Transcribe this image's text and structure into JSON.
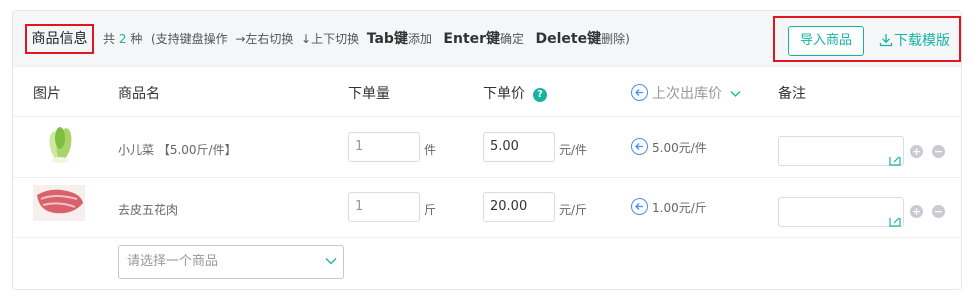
{
  "toolbar": {
    "title": "商品信息",
    "total_prefix": "共",
    "total_count": "2",
    "total_suffix": "种",
    "hint_intro": "(支持键盘操作",
    "hint_lr": "→左右切换",
    "hint_ud": "↓上下切换",
    "tab_key": "Tab键",
    "tab_action": "添加",
    "enter_key": "Enter键",
    "enter_action": "确定",
    "delete_key": "Delete键",
    "delete_action": "删除)",
    "import_label": "导入商品",
    "download_label": "下载模版"
  },
  "columns": {
    "image": "图片",
    "name": "商品名",
    "quantity": "下单量",
    "price": "下单价",
    "help": "?",
    "last_price": "上次出库价",
    "remark": "备注"
  },
  "rows": [
    {
      "name": "小儿菜 【5.00斤/件】",
      "quantity": "1",
      "quantity_unit": "件",
      "price": "5.00",
      "price_unit": "元/件",
      "last_price": "5.00元/件"
    },
    {
      "name": "去皮五花肉",
      "quantity": "1",
      "quantity_unit": "斤",
      "price": "20.00",
      "price_unit": "元/斤",
      "last_price": "1.00元/斤"
    }
  ],
  "add_row": {
    "placeholder": "请选择一个商品"
  },
  "row_actions": {
    "add": "+",
    "remove": "−"
  },
  "colors": {
    "accent": "#17b3a3",
    "highlight": "#e0161e",
    "link_blue": "#4a8ef0"
  }
}
